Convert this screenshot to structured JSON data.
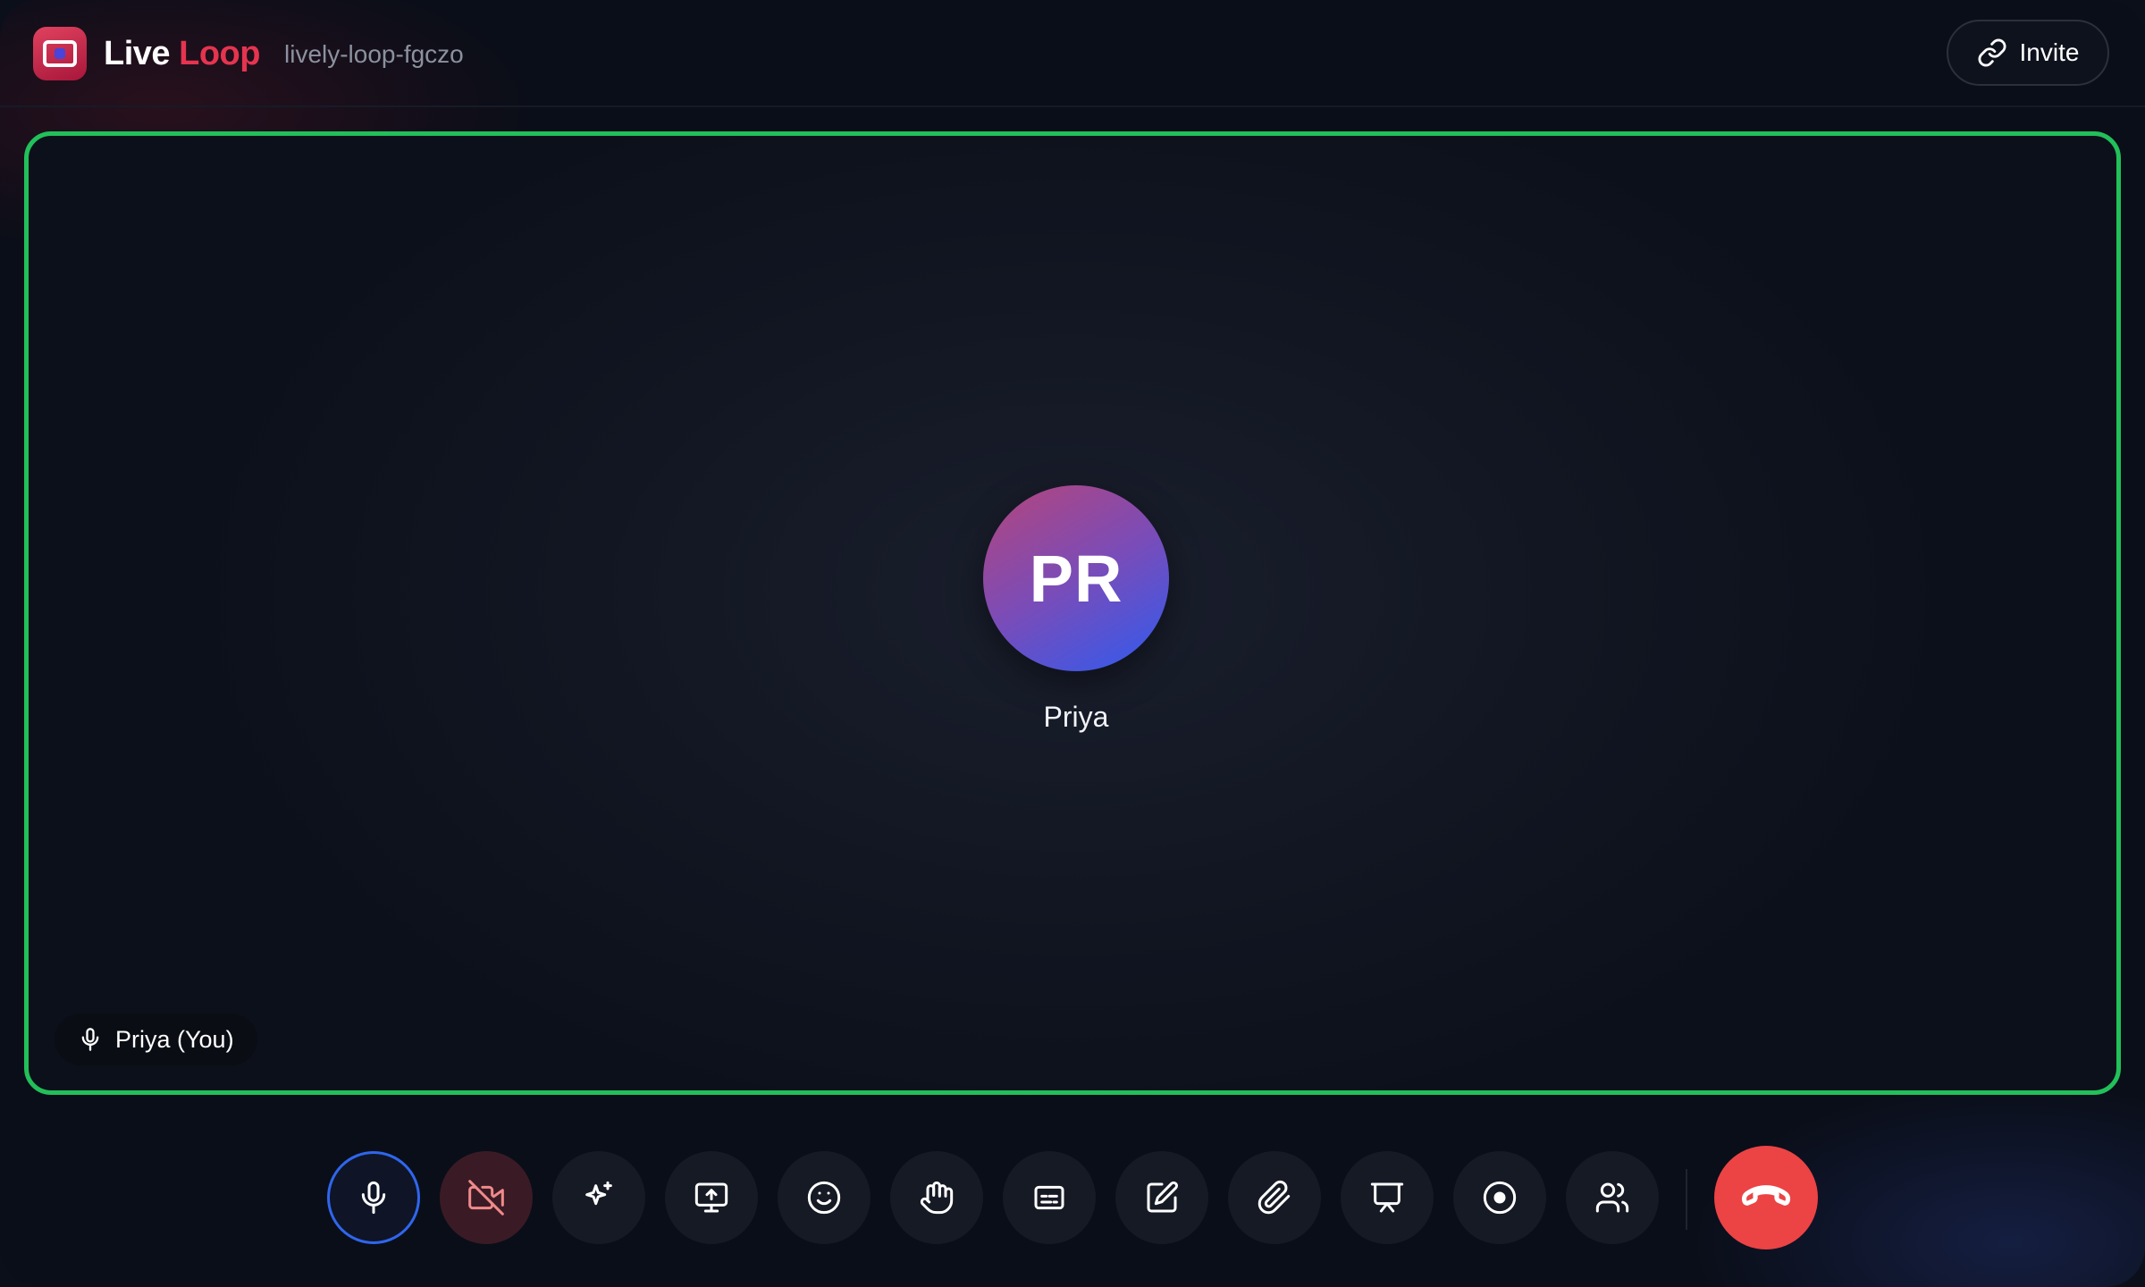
{
  "app": {
    "brand_part1": "Live",
    "brand_part2": "Loop",
    "room_id": "lively-loop-fgczo",
    "accent_color": "#e5344f"
  },
  "header": {
    "invite_label": "Invite",
    "invite_icon": "link-icon"
  },
  "stage": {
    "active_speaker_border": "#22c05a",
    "avatar_initials": "PR",
    "participant_name": "Priya",
    "self_label": "Priya (You)",
    "self_icon": "mic-icon"
  },
  "toolbar": {
    "buttons": [
      {
        "name": "microphone",
        "icon": "mic-icon",
        "state": "on"
      },
      {
        "name": "camera",
        "icon": "camera-off-icon",
        "state": "off"
      },
      {
        "name": "effects",
        "icon": "sparkles-icon"
      },
      {
        "name": "share-screen",
        "icon": "screen-share-icon"
      },
      {
        "name": "reactions",
        "icon": "smile-icon"
      },
      {
        "name": "raise-hand",
        "icon": "hand-icon"
      },
      {
        "name": "captions",
        "icon": "captions-icon"
      },
      {
        "name": "whiteboard",
        "icon": "edit-icon"
      },
      {
        "name": "attach-file",
        "icon": "paperclip-icon"
      },
      {
        "name": "present",
        "icon": "presentation-icon"
      },
      {
        "name": "record",
        "icon": "record-icon"
      },
      {
        "name": "participants",
        "icon": "users-icon"
      }
    ],
    "end_call": {
      "icon": "phone-hangup-icon",
      "color": "#ec4345"
    }
  }
}
